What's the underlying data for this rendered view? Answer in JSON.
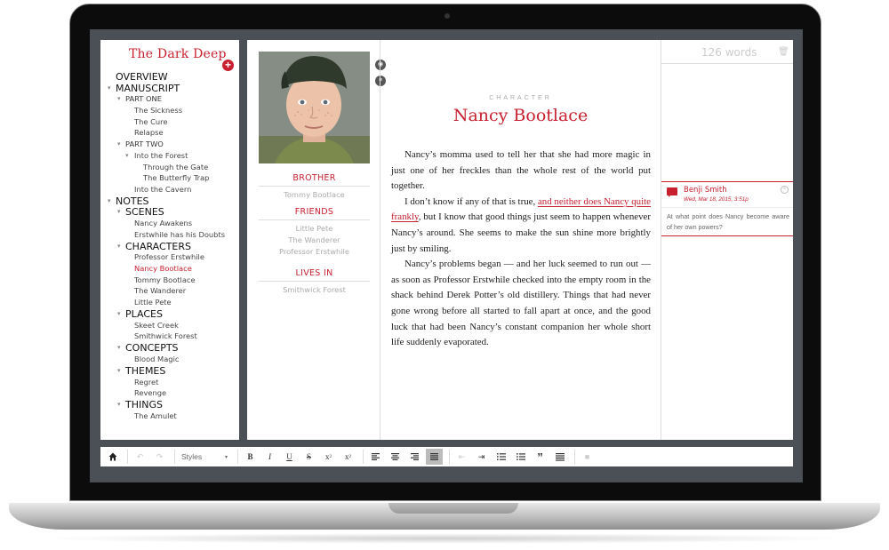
{
  "sidebar": {
    "project_title": "The Dark Deep",
    "add_icon": "plus-circle-icon",
    "tree": [
      {
        "label": "OVERVIEW",
        "level": 0,
        "toggle": false
      },
      {
        "label": "MANUSCRIPT",
        "level": 0,
        "toggle": true
      },
      {
        "label": "PART ONE",
        "level": 1,
        "toggle": true
      },
      {
        "label": "The Sickness",
        "level": 2,
        "toggle": false
      },
      {
        "label": "The Cure",
        "level": 2,
        "toggle": false
      },
      {
        "label": "Relapse",
        "level": 2,
        "toggle": false
      },
      {
        "label": "PART TWO",
        "level": 1,
        "toggle": true
      },
      {
        "label": "Into the Forest",
        "level": 2,
        "toggle": true
      },
      {
        "label": "Through the Gate",
        "level": 3,
        "toggle": false
      },
      {
        "label": "The Butterfly Trap",
        "level": 3,
        "toggle": false
      },
      {
        "label": "Into the Cavern",
        "level": 2,
        "toggle": false
      },
      {
        "label": "NOTES",
        "level": 0,
        "toggle": true
      },
      {
        "label": "SCENES",
        "level": 0.5,
        "toggle": true
      },
      {
        "label": "Nancy Awakens",
        "level": 2,
        "toggle": false
      },
      {
        "label": "Erstwhile has his Doubts",
        "level": 2,
        "toggle": false
      },
      {
        "label": "CHARACTERS",
        "level": 0.5,
        "toggle": true
      },
      {
        "label": "Professor Erstwhile",
        "level": 2,
        "toggle": false
      },
      {
        "label": "Nancy Bootlace",
        "level": 2,
        "toggle": false,
        "active": true
      },
      {
        "label": "Tommy Bootlace",
        "level": 2,
        "toggle": false
      },
      {
        "label": "The Wanderer",
        "level": 2,
        "toggle": false
      },
      {
        "label": "Little Pete",
        "level": 2,
        "toggle": false
      },
      {
        "label": "PLACES",
        "level": 0.5,
        "toggle": true
      },
      {
        "label": "Skeet Creek",
        "level": 2,
        "toggle": false
      },
      {
        "label": "Smithwick Forest",
        "level": 2,
        "toggle": false
      },
      {
        "label": "CONCEPTS",
        "level": 0.5,
        "toggle": true
      },
      {
        "label": "Blood Magic",
        "level": 2,
        "toggle": false
      },
      {
        "label": "THEMES",
        "level": 0.5,
        "toggle": true
      },
      {
        "label": "Regret",
        "level": 2,
        "toggle": false
      },
      {
        "label": "Revenge",
        "level": 2,
        "toggle": false
      },
      {
        "label": "THINGS",
        "level": 0.5,
        "toggle": true
      },
      {
        "label": "The Amulet",
        "level": 2,
        "toggle": false
      }
    ]
  },
  "character_sheet": {
    "brother_heading": "BROTHER",
    "brother": [
      "Tommy Bootlace"
    ],
    "friends_heading": "FRIENDS",
    "friends": [
      "Little Pete",
      "The Wanderer",
      "Professor Erstwhile"
    ],
    "lives_heading": "LIVES IN",
    "lives": [
      "Smithwick Forest"
    ]
  },
  "document": {
    "kicker": "CHARACTER",
    "title": "Nancy Bootlace",
    "p1": "Nancy’s momma used to tell her that she had more magic in just one of her freckles than the whole rest of the world put together.",
    "p2_a": "I don’t know if any of that is true, ",
    "p2_hl": "and neither does Nancy quite frankly",
    "p2_b": ", but I know that good things just seem to happen whenever Nancy’s around. She seems to make the sun shine more brightly just by smiling.",
    "p3": "Nancy’s problems began — and her luck seemed to run out — as soon as Professor Erstwhile checked into the empty room in the shack behind Derek Potter’s old distillery. Things that had never gone wrong before all started to fall apart at once, and the good luck that had been Nancy’s constant companion her whole short life suddenly evaporated."
  },
  "comments_panel": {
    "word_count": "126 words",
    "comment": {
      "author": "Benji Smith",
      "date": "Wed, Mar 18, 2015, 3:51p",
      "text": "At what point does Nancy become aware of her own powers?"
    }
  },
  "toolbar": {
    "styles_label": "Styles"
  },
  "colors": {
    "accent": "#c8202f",
    "screen_bg": "#4b4f56"
  }
}
